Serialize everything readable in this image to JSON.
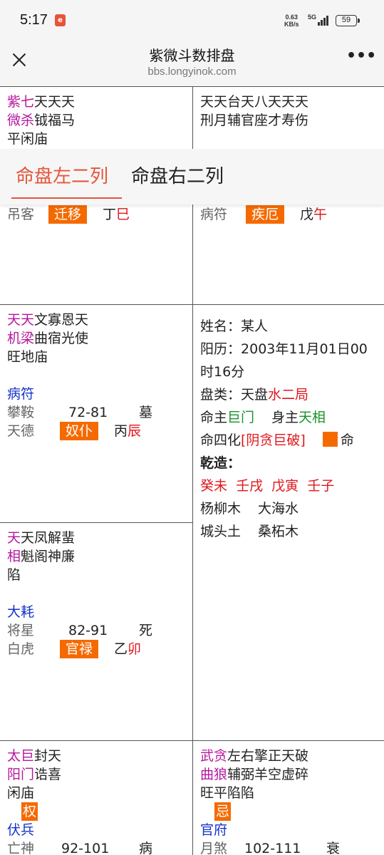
{
  "status_bar": {
    "time": "5:17",
    "app_badge": "e",
    "speed_value": "0.63",
    "speed_unit": "KB/s",
    "network": "5G",
    "battery": "59"
  },
  "header": {
    "title": "紫微斗数排盘",
    "url": "bbs.longyinok.com",
    "more_label": "•••"
  },
  "tabs": [
    {
      "label": "命盘左二列"
    },
    {
      "label": "命盘右二列"
    }
  ],
  "cells": {
    "top_left": {
      "row1": {
        "main": "紫七",
        "minor": "天天天"
      },
      "row2": {
        "main": "微杀",
        "minor": "钺福马"
      },
      "row3": "平闲庙",
      "peek_left": "吊客",
      "peek_tag": "迁移",
      "peek_stem": "丁",
      "peek_branch": "巳"
    },
    "top_right": {
      "row1": "天天台天八天天天",
      "row2": "刑月辅官座才寿伤",
      "peek_left": "病符",
      "peek_tag": "疾厄",
      "peek_stem": "戊",
      "peek_branch": "午"
    },
    "mid_left_1": {
      "row1": {
        "main": "天天",
        "minor": "文寡恩天"
      },
      "row2": {
        "main": "机梁",
        "minor": "曲宿光使"
      },
      "row3": "旺地庙",
      "god": "病符",
      "star1": "攀鞍",
      "age": "72-81",
      "stage": "墓",
      "star2": "天德",
      "palace": "奴仆",
      "stem": "丙",
      "branch": "辰"
    },
    "mid_left_2": {
      "row1": {
        "main": "天",
        "minor": "天凤解蜚"
      },
      "row2": {
        "main": "相",
        "minor": "魁阁神廉"
      },
      "row3": "陷",
      "god": "大耗",
      "star1": "将星",
      "age": "82-91",
      "stage": "死",
      "star2": "白虎",
      "palace": "官禄",
      "stem": "乙",
      "branch": "卯"
    },
    "bottom_left": {
      "row1": {
        "main": "太巨",
        "minor": "封天"
      },
      "row2": {
        "main": "阳门",
        "minor": "诰喜"
      },
      "row3": "闲庙",
      "hua": "权",
      "god": "伏兵",
      "star1": "亡神",
      "age": "92-101",
      "stage": "病"
    },
    "bottom_right": {
      "row1": {
        "main": "武贪",
        "minor": "左右擎正天破"
      },
      "row2": {
        "main": "曲狼",
        "minor": "辅弼羊空虚碎"
      },
      "row3": "旺平陷陷",
      "hua": "忌",
      "god": "官府",
      "star1": "月煞",
      "age": "102-111",
      "stage": "衰"
    }
  },
  "info": {
    "name_label": "姓名：",
    "name_value": "某人",
    "solar_label": "阳历：",
    "solar_value": "2003年11月01日00",
    "solar_value_2": "时16分",
    "type_label": "盘类：",
    "type_value": "天盘",
    "bureau": "水二局",
    "ming_label": "命主",
    "ming_value": "巨门",
    "shen_label": "身主",
    "shen_value": "天相",
    "sihua_label": "命四化",
    "sihua_value": "[阴贪巨破]",
    "ming_marker": "命",
    "qianzao": "乾造：",
    "pillars": [
      "癸未",
      "壬戌",
      "戊寅",
      "壬子"
    ],
    "nayin_1": "杨柳木",
    "nayin_2": "大海水",
    "nayin_3": "城头土",
    "nayin_4": "桑柘木"
  }
}
